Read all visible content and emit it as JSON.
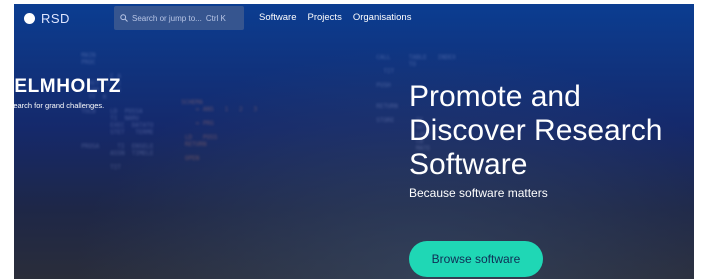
{
  "navbar": {
    "logo_text": "RSD",
    "search": {
      "placeholder": "Search or jump to...",
      "shortcut": "Ctrl K"
    },
    "links": [
      "Software",
      "Projects",
      "Organisations"
    ]
  },
  "brand": {
    "title": "HELMHOLTZ",
    "tagline": "Research for grand challenges."
  },
  "hero": {
    "headline": "Promote and Discover Research Software",
    "subline": "Because software matters",
    "cta_label": "Browse software"
  },
  "colors": {
    "accent": "#1fd7b5",
    "nav_search_bg": "#36558f",
    "hero_top": "#0b3d91",
    "hero_bottom": "#2a2d3a"
  }
}
